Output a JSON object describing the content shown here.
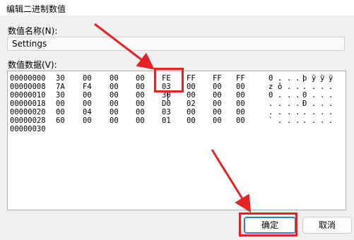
{
  "window": {
    "title": "编辑二进制数值",
    "close_glyph": "✕"
  },
  "value_name": {
    "label": "数值名称(N):",
    "value": "Settings"
  },
  "value_data": {
    "label": "数值数据(V):",
    "rows": [
      {
        "addr": "00000000",
        "bytes": [
          "30",
          "00",
          "00",
          "00",
          "FE",
          "FF",
          "FF",
          "FF"
        ],
        "ascii": [
          "0",
          ".",
          ".",
          ".",
          "þ",
          "ÿ",
          "ÿ",
          "ÿ"
        ]
      },
      {
        "addr": "00000008",
        "bytes": [
          "7A",
          "F4",
          "00",
          "00",
          "03",
          "00",
          "00",
          "00"
        ],
        "ascii": [
          "z",
          "ô",
          ".",
          ".",
          ".",
          ".",
          ".",
          "."
        ]
      },
      {
        "addr": "00000010",
        "bytes": [
          "30",
          "00",
          "00",
          "00",
          "30",
          "00",
          "00",
          "00"
        ],
        "ascii": [
          "0",
          ".",
          ".",
          ".",
          "0",
          ".",
          ".",
          "."
        ]
      },
      {
        "addr": "00000018",
        "bytes": [
          "00",
          "00",
          "00",
          "00",
          "D0",
          "02",
          "00",
          "00"
        ],
        "ascii": [
          ".",
          ".",
          ".",
          ".",
          "Ð",
          ".",
          ".",
          "."
        ]
      },
      {
        "addr": "00000020",
        "bytes": [
          "00",
          "04",
          "00",
          "00",
          "03",
          "00",
          "00",
          "00"
        ],
        "ascii": [
          ".",
          ".",
          ".",
          ".",
          ".",
          ".",
          ".",
          "."
        ]
      },
      {
        "addr": "00000028",
        "bytes": [
          "60",
          "00",
          "00",
          "00",
          "01",
          "00",
          "00",
          "00"
        ],
        "ascii": [
          "`",
          ".",
          ".",
          ".",
          ".",
          ".",
          ".",
          "."
        ]
      },
      {
        "addr": "00000030",
        "bytes": [],
        "ascii": []
      }
    ]
  },
  "buttons": {
    "ok": "确定",
    "cancel": "取消"
  },
  "annotation_color": "#e52324"
}
